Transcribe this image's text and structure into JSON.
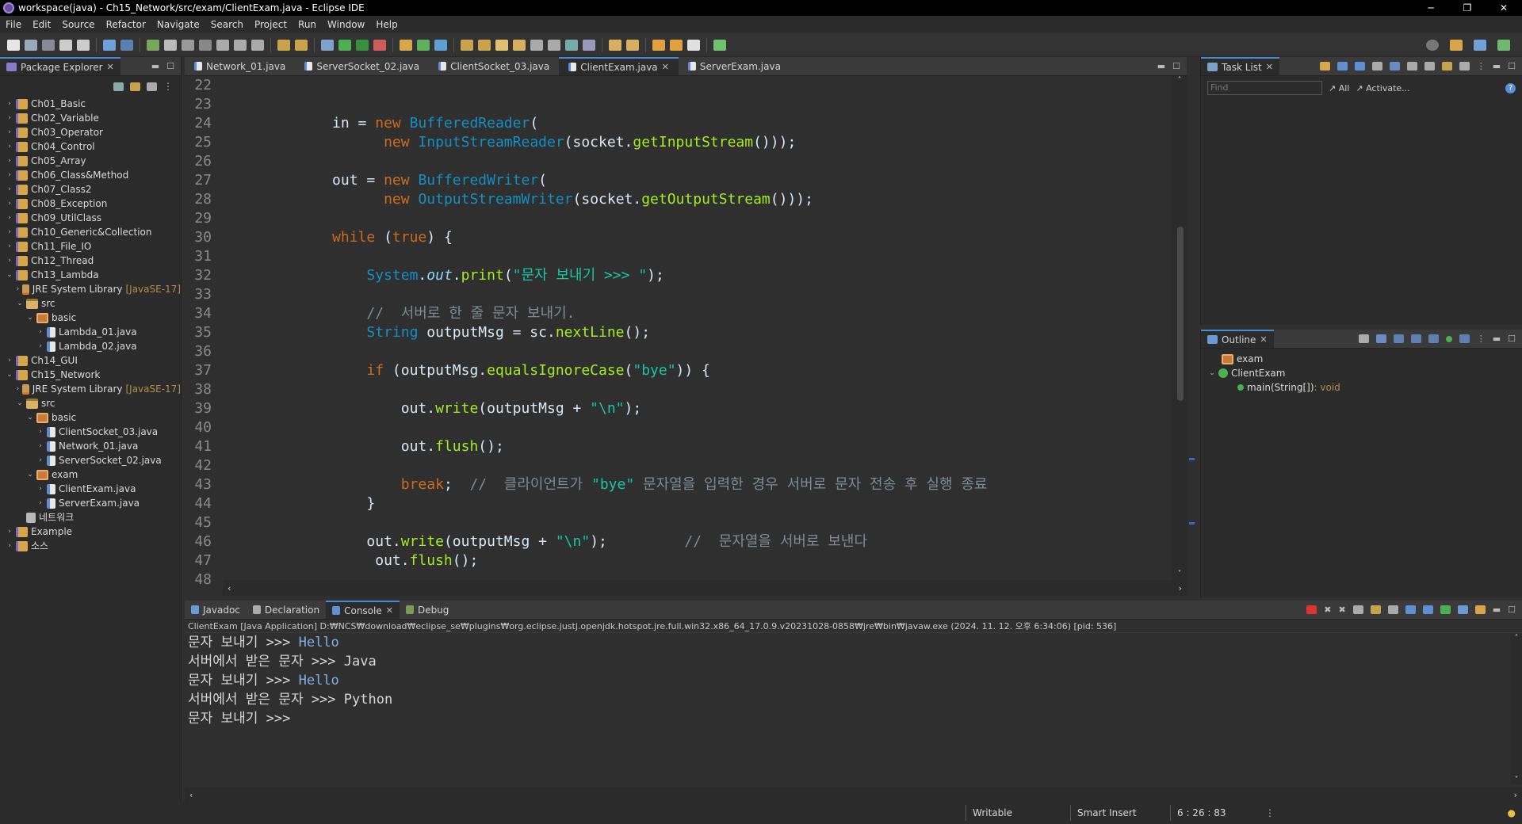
{
  "window": {
    "title": "workspace(java) - Ch15_Network/src/exam/ClientExam.java - Eclipse IDE",
    "min": "─",
    "restore": "❐",
    "close": "✕"
  },
  "menu": [
    "File",
    "Edit",
    "Source",
    "Refactor",
    "Navigate",
    "Search",
    "Project",
    "Run",
    "Window",
    "Help"
  ],
  "package_explorer": {
    "title": "Package Explorer",
    "tree": [
      {
        "label": "Ch01_Basic",
        "indent": 0,
        "type": "proj",
        "arrow": "›"
      },
      {
        "label": "Ch02_Variable",
        "indent": 0,
        "type": "proj",
        "arrow": "›"
      },
      {
        "label": "Ch03_Operator",
        "indent": 0,
        "type": "proj",
        "arrow": "›"
      },
      {
        "label": "Ch04_Control",
        "indent": 0,
        "type": "proj",
        "arrow": "›"
      },
      {
        "label": "Ch05_Array",
        "indent": 0,
        "type": "proj",
        "arrow": "›"
      },
      {
        "label": "Ch06_Class&Method",
        "indent": 0,
        "type": "proj",
        "arrow": "›"
      },
      {
        "label": "Ch07_Class2",
        "indent": 0,
        "type": "proj",
        "arrow": "›"
      },
      {
        "label": "Ch08_Exception",
        "indent": 0,
        "type": "proj",
        "arrow": "›"
      },
      {
        "label": "Ch09_UtilClass",
        "indent": 0,
        "type": "proj",
        "arrow": "›"
      },
      {
        "label": "Ch10_Generic&Collection",
        "indent": 0,
        "type": "proj",
        "arrow": "›"
      },
      {
        "label": "Ch11_File_IO",
        "indent": 0,
        "type": "proj",
        "arrow": "›"
      },
      {
        "label": "Ch12_Thread",
        "indent": 0,
        "type": "proj",
        "arrow": "›"
      },
      {
        "label": "Ch13_Lambda",
        "indent": 0,
        "type": "proj",
        "arrow": "⌄"
      },
      {
        "label": "JRE System Library",
        "deco": "[JavaSE-17]",
        "indent": 1,
        "type": "lib",
        "arrow": "›"
      },
      {
        "label": "src",
        "indent": 1,
        "type": "src",
        "arrow": "⌄"
      },
      {
        "label": "basic",
        "indent": 2,
        "type": "pkg",
        "arrow": "⌄"
      },
      {
        "label": "Lambda_01.java",
        "indent": 3,
        "type": "jfile",
        "arrow": "›"
      },
      {
        "label": "Lambda_02.java",
        "indent": 3,
        "type": "jfile",
        "arrow": "›"
      },
      {
        "label": "Ch14_GUI",
        "indent": 0,
        "type": "proj",
        "arrow": "›"
      },
      {
        "label": "Ch15_Network",
        "indent": 0,
        "type": "proj",
        "arrow": "⌄"
      },
      {
        "label": "JRE System Library",
        "deco": "[JavaSE-17]",
        "indent": 1,
        "type": "lib",
        "arrow": "›"
      },
      {
        "label": "src",
        "indent": 1,
        "type": "src",
        "arrow": "⌄"
      },
      {
        "label": "basic",
        "indent": 2,
        "type": "pkg",
        "arrow": "⌄"
      },
      {
        "label": "ClientSocket_03.java",
        "indent": 3,
        "type": "jfile",
        "arrow": "›"
      },
      {
        "label": "Network_01.java",
        "indent": 3,
        "type": "jfile",
        "arrow": "›"
      },
      {
        "label": "ServerSocket_02.java",
        "indent": 3,
        "type": "jfile",
        "arrow": "›"
      },
      {
        "label": "exam",
        "indent": 2,
        "type": "pkg",
        "arrow": "⌄"
      },
      {
        "label": "ClientExam.java",
        "indent": 3,
        "type": "jfile",
        "arrow": "›"
      },
      {
        "label": "ServerExam.java",
        "indent": 3,
        "type": "jfile",
        "arrow": "›"
      },
      {
        "label": "네트워크",
        "indent": 1,
        "type": "folder",
        "arrow": ""
      },
      {
        "label": "Example",
        "indent": 0,
        "type": "proj",
        "arrow": "›"
      },
      {
        "label": "소스",
        "indent": 0,
        "type": "proj",
        "arrow": "›"
      }
    ]
  },
  "editor": {
    "tabs": [
      {
        "label": "Network_01.java",
        "active": false
      },
      {
        "label": "ServerSocket_02.java",
        "active": false
      },
      {
        "label": "ClientSocket_03.java",
        "active": false
      },
      {
        "label": "ClientExam.java",
        "active": true
      },
      {
        "label": "ServerExam.java",
        "active": false
      }
    ],
    "lines": [
      {
        "n": "22",
        "html": ""
      },
      {
        "n": "23",
        "html": ""
      },
      {
        "n": "24",
        "html": "            in = <span class=\"kw\">new</span> <span class=\"cls\">BufferedReader</span>("
      },
      {
        "n": "25",
        "html": "                  <span class=\"kw\">new</span> <span class=\"cls\">InputStreamReader</span>(socket.<span class=\"mth\">getInputStream</span>()));"
      },
      {
        "n": "26",
        "html": ""
      },
      {
        "n": "27",
        "html": "            out = <span class=\"kw\">new</span> <span class=\"cls\">BufferedWriter</span>("
      },
      {
        "n": "28",
        "html": "                  <span class=\"kw\">new</span> <span class=\"cls\">OutputStreamWriter</span>(socket.<span class=\"mth\">getOutputStream</span>()));"
      },
      {
        "n": "29",
        "html": ""
      },
      {
        "n": "30",
        "html": "            <span class=\"kw\">while</span> (<span class=\"kw\">true</span>) {"
      },
      {
        "n": "31",
        "html": ""
      },
      {
        "n": "32",
        "html": "                <span class=\"cls\">System</span>.<span class=\"fld\">out</span>.<span class=\"mth\">print</span>(<span class=\"str\">\"문자 보내기 >>> \"</span>);"
      },
      {
        "n": "33",
        "html": ""
      },
      {
        "n": "34",
        "html": "                <span class=\"cmt\">//  서버로 한 줄 문자 보내기.</span>"
      },
      {
        "n": "35",
        "html": "                <span class=\"cls\">String</span> outputMsg = sc.<span class=\"mth\">nextLine</span>();"
      },
      {
        "n": "36",
        "html": ""
      },
      {
        "n": "37",
        "html": "                <span class=\"kw\">if</span> (outputMsg.<span class=\"mth\">equalsIgnoreCase</span>(<span class=\"str\">\"bye\"</span>)) {"
      },
      {
        "n": "38",
        "html": ""
      },
      {
        "n": "39",
        "html": "                    out.<span class=\"mth\">write</span>(outputMsg + <span class=\"str\">\"\\n\"</span>);"
      },
      {
        "n": "40",
        "html": ""
      },
      {
        "n": "41",
        "html": "                    out.<span class=\"mth\">flush</span>();"
      },
      {
        "n": "42",
        "html": ""
      },
      {
        "n": "43",
        "html": "                    <span class=\"kw\">break</span>;  <span class=\"cmt\">//  클라이언트가 </span><span class=\"str\">\"bye\"</span><span class=\"cmt\"> 문자열을 입력한 경우 서버로 문자 전송 후 실행 종료</span>"
      },
      {
        "n": "44",
        "html": "                }"
      },
      {
        "n": "45",
        "html": ""
      },
      {
        "n": "46",
        "html": "                out.<span class=\"mth\">write</span>(outputMsg + <span class=\"str\">\"\\n\"</span>);         <span class=\"cmt\">//  문자열을 서버로 보낸다</span>"
      },
      {
        "n": "47",
        "html": "                 out.<span class=\"mth\">flush</span>();"
      },
      {
        "n": "48",
        "html": ""
      }
    ]
  },
  "task_list": {
    "title": "Task List",
    "find_placeholder": "Find",
    "all_label": "All",
    "activate_label": "Activate..."
  },
  "outline": {
    "title": "Outline",
    "package": "exam",
    "class": "ClientExam",
    "method": "main(String[])",
    "method_type": " : void"
  },
  "bottom": {
    "tabs": [
      {
        "label": "Javadoc",
        "active": false
      },
      {
        "label": "Declaration",
        "active": false
      },
      {
        "label": "Console",
        "active": true
      },
      {
        "label": "Debug",
        "active": false
      }
    ],
    "console_header": "ClientExam [Java Application] D:₩NCS₩download₩eclipse_se₩plugins₩org.eclipse.justj.openjdk.hotspot.jre.full.win32.x86_64_17.0.9.v20231028-0858₩jre₩bin₩javaw.exe  (2024. 11. 12. 오후 6:34:06) [pid: 536]",
    "output": [
      {
        "prompt": "문자 보내기 >>> ",
        "input": "Hello"
      },
      {
        "prompt": "서버에서 받은 문자 >>> Java",
        "input": ""
      },
      {
        "prompt": "문자 보내기 >>> ",
        "input": "Hello"
      },
      {
        "prompt": "서버에서 받은 문자 >>> Python",
        "input": ""
      },
      {
        "prompt": "문자 보내기 >>> ",
        "input": ""
      }
    ]
  },
  "status": {
    "writable": "Writable",
    "insert_mode": "Smart Insert",
    "position": "6 : 26 : 83"
  },
  "colors": {
    "keyword": "#cc6c1d",
    "class": "#1290c3",
    "method": "#a7ec21",
    "string": "#17c6a3",
    "comment": "#7d8c93",
    "accent": "#4a8ad4"
  }
}
